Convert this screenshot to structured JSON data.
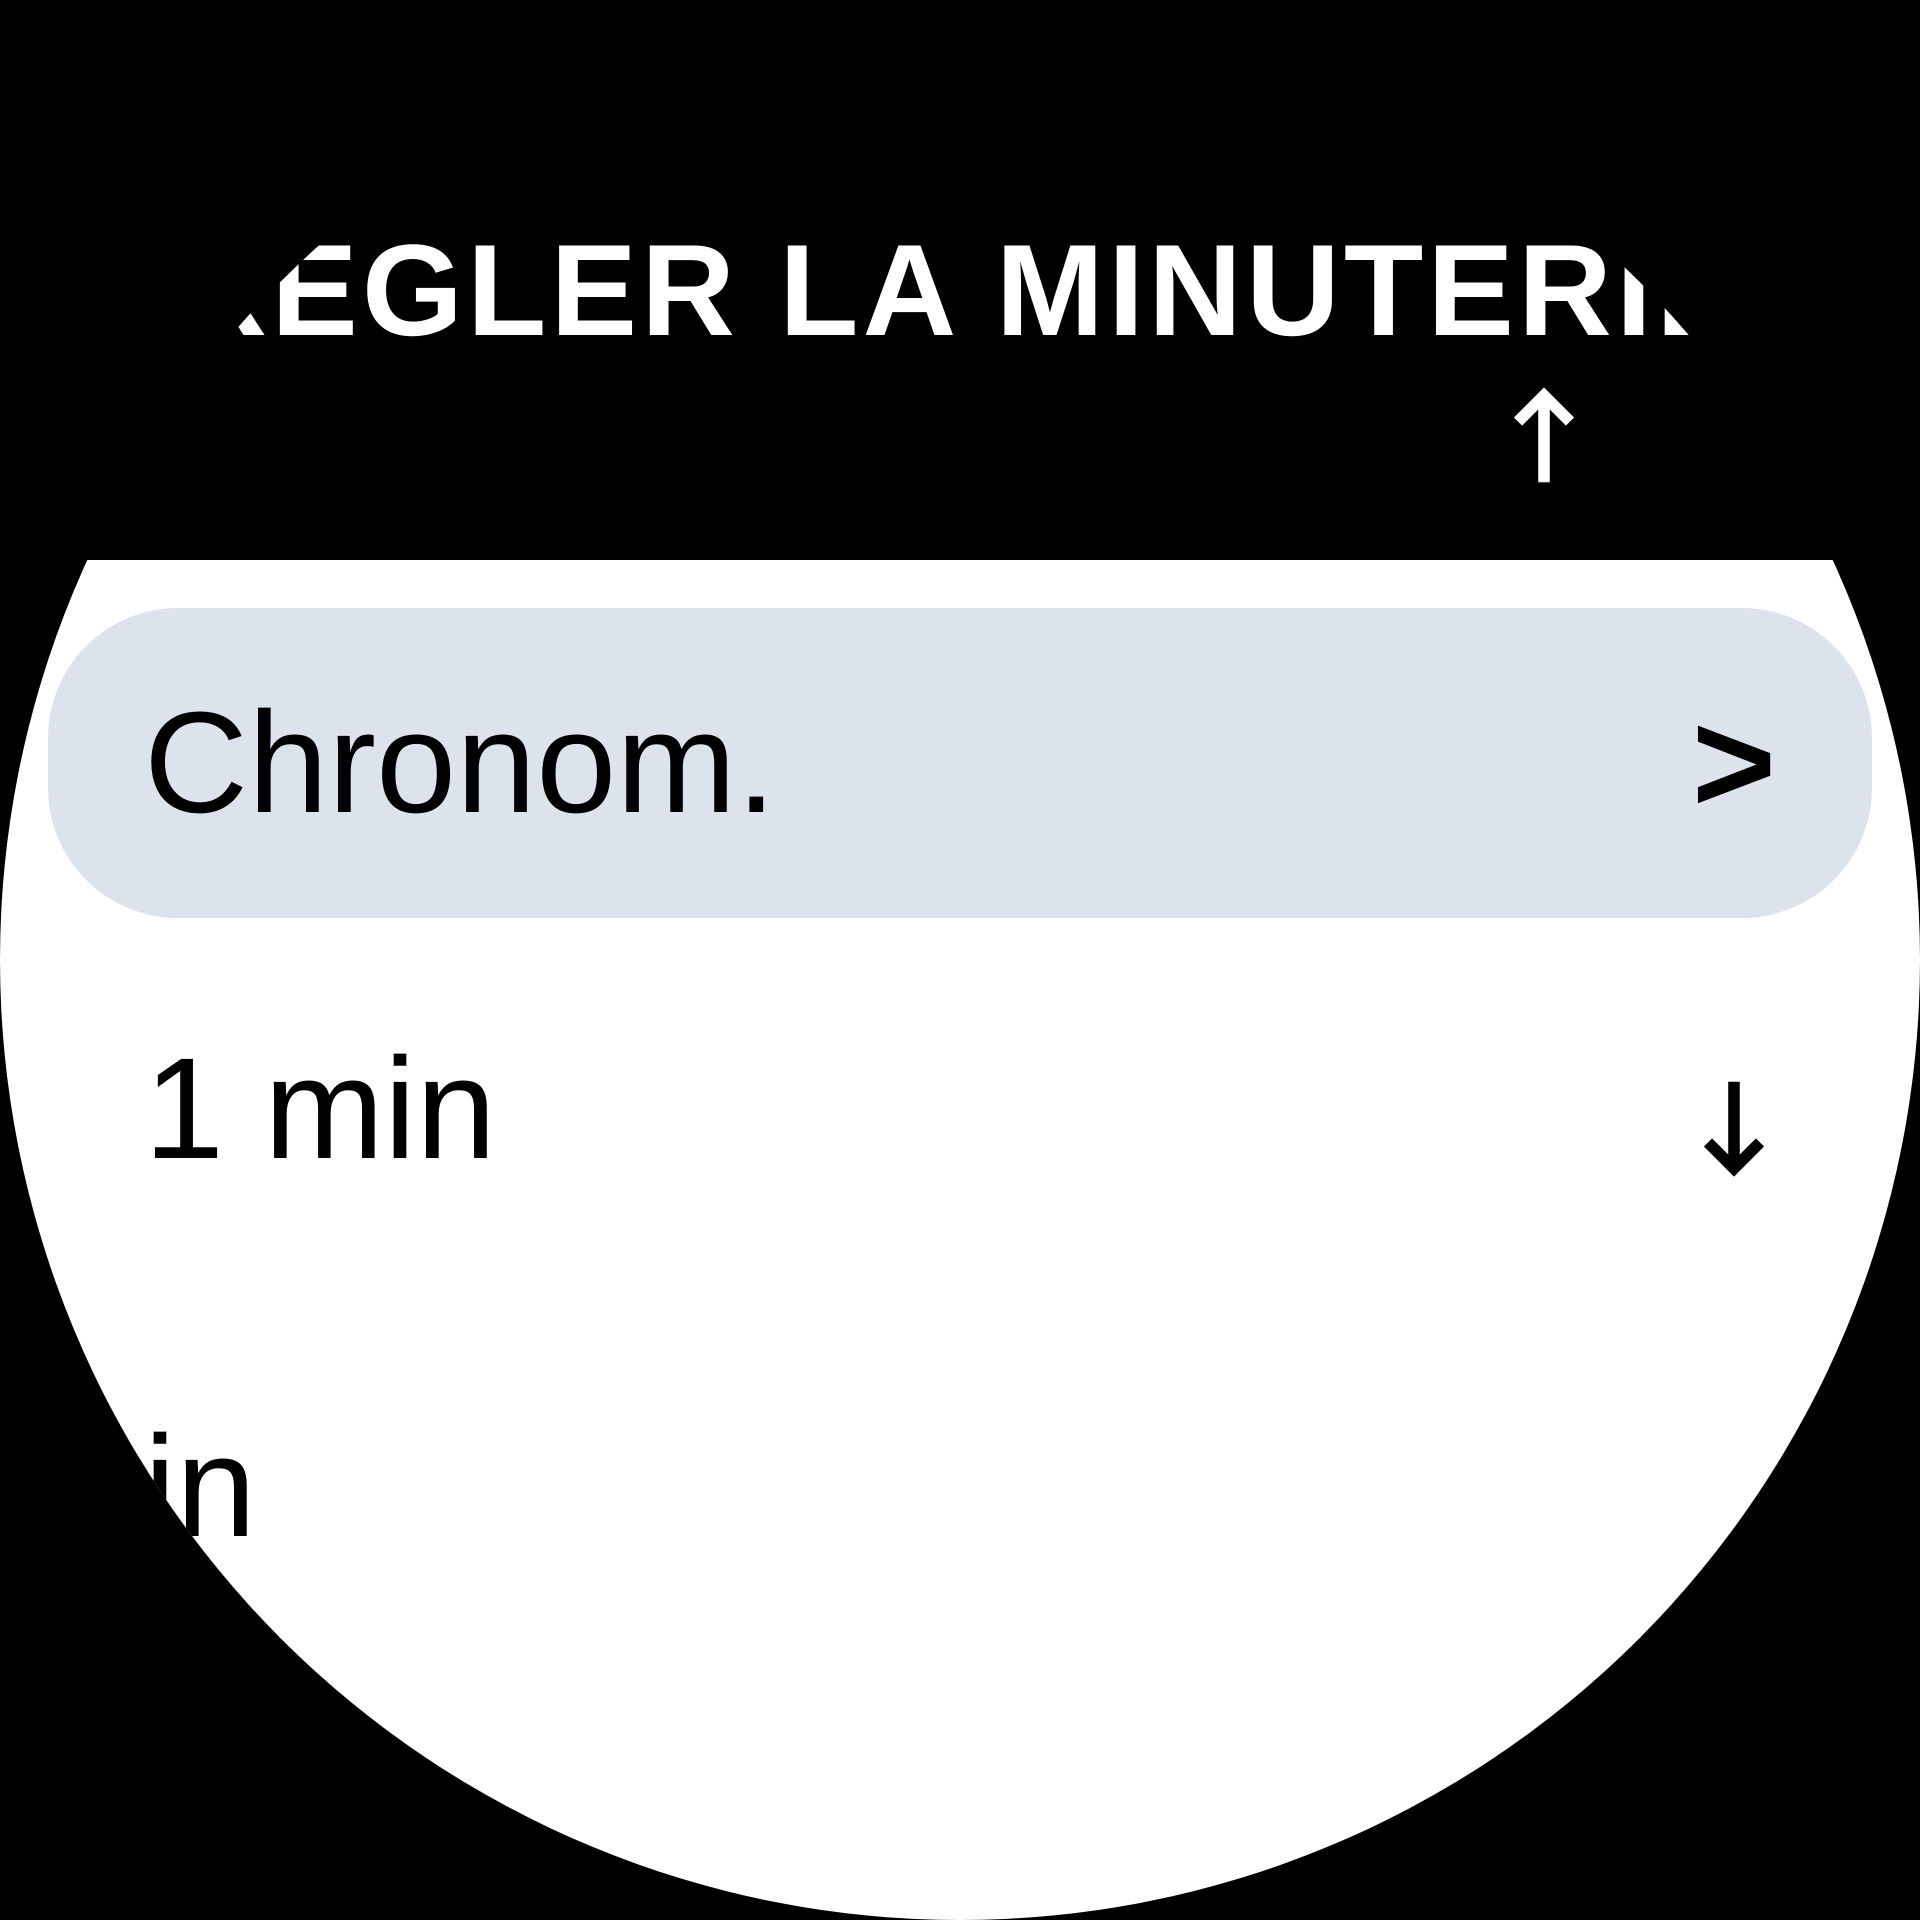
{
  "header": {
    "title": "RÉGLER LA MINUTERIE"
  },
  "list": {
    "items": [
      {
        "label": "Chronom.",
        "selected": true,
        "hasChevron": true
      },
      {
        "label": "1 min",
        "selected": false,
        "hasChevron": false
      },
      {
        "label": "in",
        "selected": false,
        "hasChevron": false
      }
    ]
  },
  "icons": {
    "up_arrow": "arrow-up",
    "down_arrow": "arrow-down",
    "chevron": ">"
  }
}
